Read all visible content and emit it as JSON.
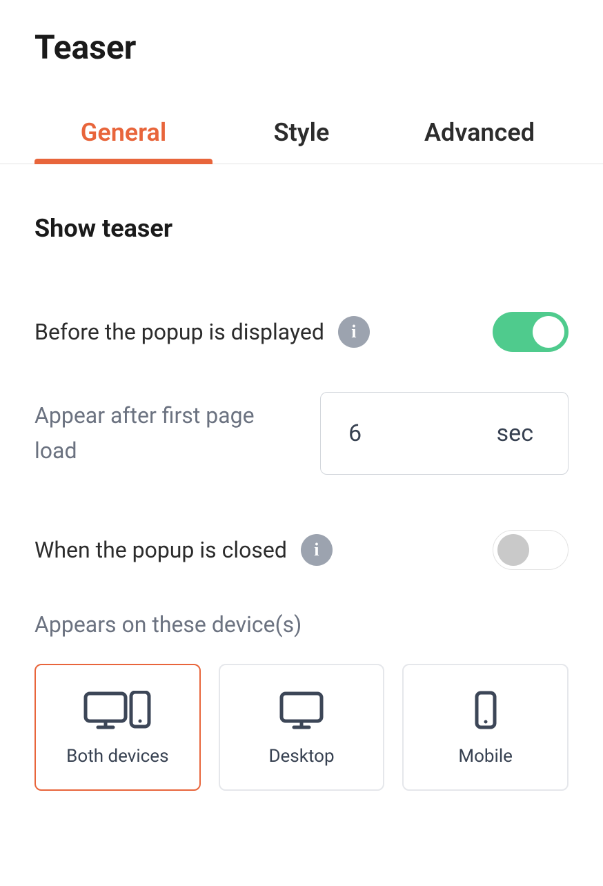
{
  "header": {
    "title": "Teaser"
  },
  "tabs": [
    {
      "label": "General",
      "active": true
    },
    {
      "label": "Style",
      "active": false
    },
    {
      "label": "Advanced",
      "active": false
    }
  ],
  "section": {
    "title": "Show teaser"
  },
  "settings": {
    "before_popup": {
      "label": "Before the popup is displayed",
      "enabled": true
    },
    "appear_after": {
      "label": "Appear after first page load",
      "value": "6",
      "unit": "sec"
    },
    "when_closed": {
      "label": "When the popup is closed",
      "enabled": false
    },
    "devices": {
      "label": "Appears on these device(s)",
      "options": [
        {
          "label": "Both devices",
          "icon": "both",
          "selected": true
        },
        {
          "label": "Desktop",
          "icon": "desktop",
          "selected": false
        },
        {
          "label": "Mobile",
          "icon": "mobile",
          "selected": false
        }
      ]
    }
  }
}
